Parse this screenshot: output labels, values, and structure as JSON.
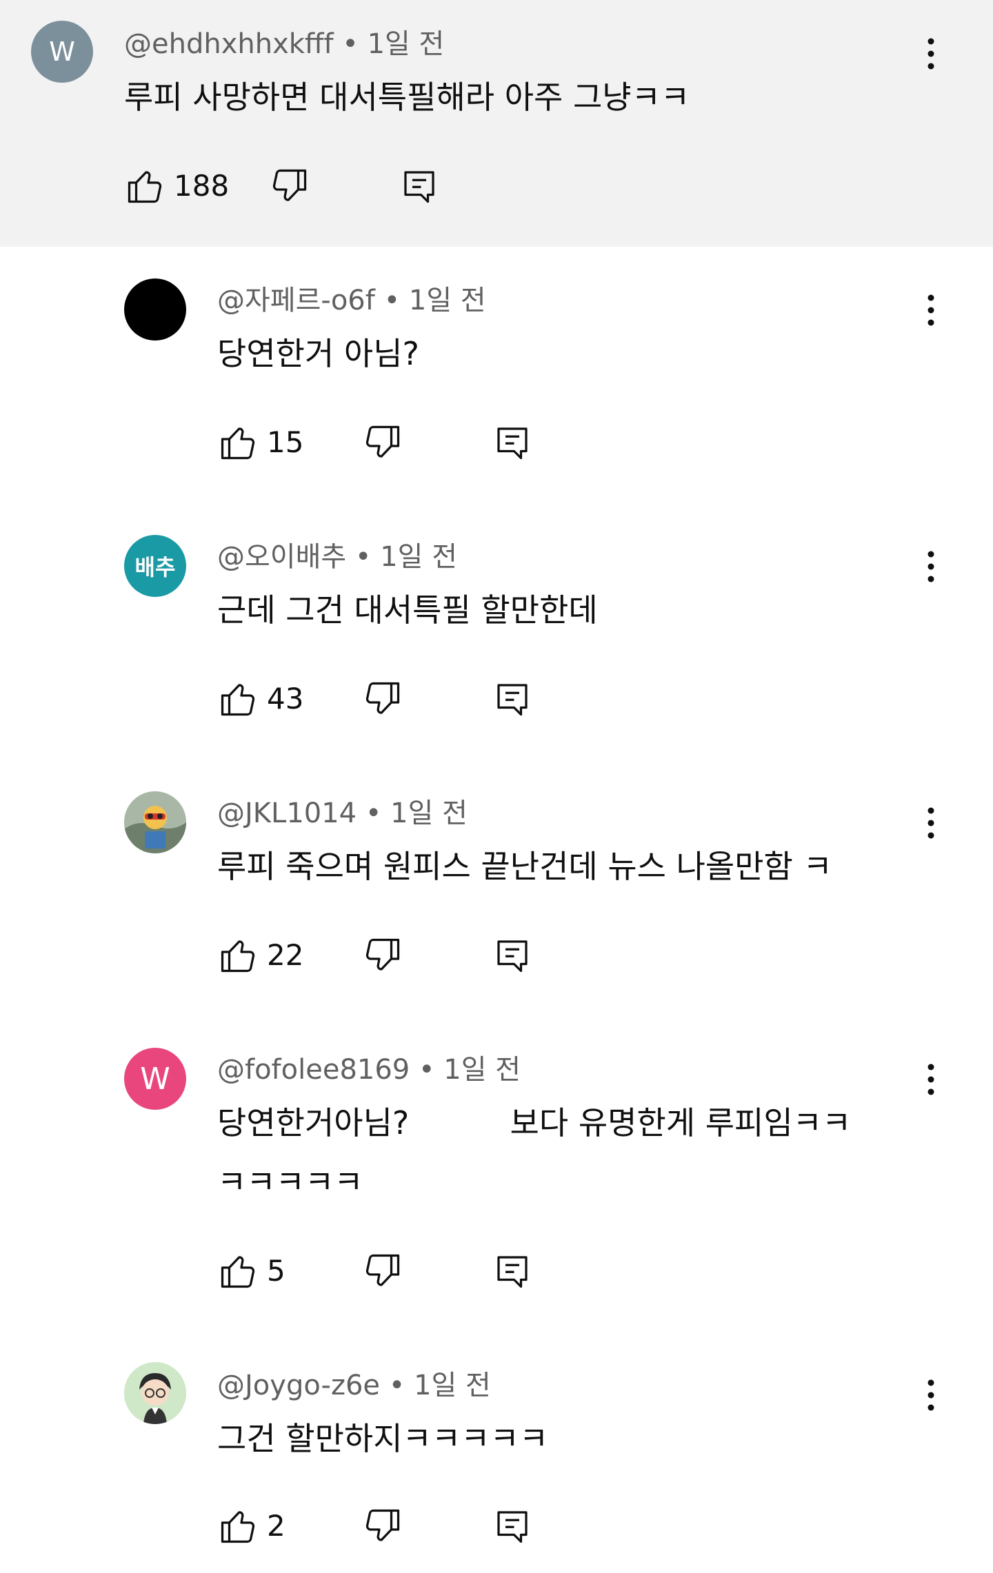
{
  "comments": [
    {
      "handle": "@ehdhxhhxkfff",
      "time": "1일 전",
      "text": "루피 사망하면 대서특필해라 아주 그냥ㅋㅋ",
      "likes": "188",
      "avatar_text": "W",
      "avatar_color": "#7c909c"
    },
    {
      "handle": "@자페르-o6f",
      "time": "1일 전",
      "text": "당연한거 아님?",
      "likes": "15",
      "avatar_text": "",
      "avatar_color": "#000000"
    },
    {
      "handle": "@오이배추",
      "time": "1일 전",
      "text": "근데 그건 대서특필 할만한데",
      "likes": "43",
      "avatar_text": "배추",
      "avatar_color": "#1a9aa4"
    },
    {
      "handle": "@JKL1014",
      "time": "1일 전",
      "text": "루피 죽으며 원피스 끝난건데 뉴스 나올만함 ㅋ",
      "likes": "22",
      "avatar_text": "",
      "avatar_color": "#9fb0a8"
    },
    {
      "handle": "@fofolee8169",
      "time": "1일 전",
      "text": "당연한거아님?          보다 유명한게 루피임ㅋㅋ\nㅋㅋㅋㅋㅋ",
      "likes": "5",
      "avatar_text": "W",
      "avatar_color": "#e8467c"
    },
    {
      "handle": "@Joygo-z6e",
      "time": "1일 전",
      "text": "그건 할만하지ㅋㅋㅋㅋㅋ",
      "likes": "2",
      "avatar_text": "",
      "avatar_color": "#cfe8c8"
    }
  ],
  "separator": "•"
}
